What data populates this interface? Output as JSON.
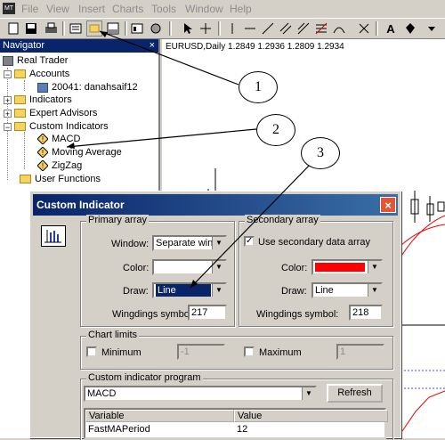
{
  "menubar": {
    "app_icon": "MT",
    "items": [
      "File",
      "View",
      "Insert",
      "Charts",
      "Tools",
      "Window",
      "Help"
    ]
  },
  "toolbar": {
    "icons": [
      "new-chart-icon",
      "save-icon",
      "print-icon",
      "properties-icon",
      "navigator-icon",
      "terminal-icon",
      "strategy-tester-icon",
      "options-icon",
      "cursor-icon",
      "crosshair-icon",
      "vertical-line-icon",
      "horizontal-line-icon",
      "trendline-icon",
      "channel-icon",
      "fibonacci-icon",
      "text-icon",
      "label-icon"
    ],
    "text_label": "A"
  },
  "navigator": {
    "title": "Navigator",
    "close": "×",
    "root": "Real Trader",
    "accounts": "Accounts",
    "account": "20041: danahsaif12",
    "indicators": "Indicators",
    "experts": "Expert Advisors",
    "custom": "Custom Indicators",
    "custom_items": [
      "MACD",
      "Moving Average",
      "ZigZag"
    ],
    "functions": "User Functions"
  },
  "chart": {
    "header": "EURUSD,Daily  1.2849 1.2936 1.2809 1.2934"
  },
  "dialog": {
    "title": "Custom Indicator",
    "close": "×",
    "primary": {
      "label": "Primary array",
      "window_label": "Window:",
      "window_value": "Separate wind",
      "color_label": "Color:",
      "draw_label": "Draw:",
      "draw_value": "Line",
      "wingdings_label": "Wingdings symbol:",
      "wingdings_value": "217"
    },
    "secondary": {
      "label": "Secondary array",
      "use_label": "Use secondary data array",
      "use_checked": "✓",
      "color_label": "Color:",
      "color_value": "#ff0000",
      "draw_label": "Draw:",
      "draw_value": "Line",
      "wingdings_label": "Wingdings symbol:",
      "wingdings_value": "218"
    },
    "limits": {
      "label": "Chart limits",
      "min_label": "Minimum",
      "min_value": "-1",
      "max_label": "Maximum",
      "max_value": "1"
    },
    "program": {
      "label": "Custom indicator program",
      "value": "MACD",
      "refresh": "Refresh",
      "col_variable": "Variable",
      "col_value": "Value",
      "rows": [
        {
          "variable": "FastMAPeriod",
          "value": "12"
        }
      ]
    }
  },
  "annotations": [
    "1",
    "2",
    "3"
  ]
}
